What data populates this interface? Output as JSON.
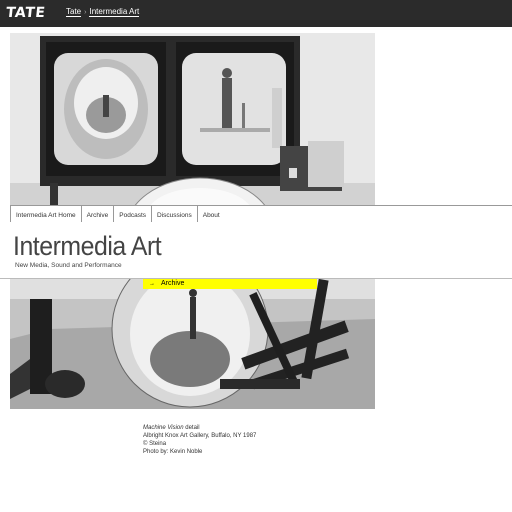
{
  "header": {
    "logo": "TATE",
    "breadcrumb": [
      "Tate",
      "Intermedia Art"
    ]
  },
  "nav": {
    "items": [
      "Intermedia Art Home",
      "Archive",
      "Podcasts",
      "Discussions",
      "About"
    ]
  },
  "page": {
    "title": "Intermedia Art",
    "subtitle": "New Media, Sound and Performance"
  },
  "archive_link": {
    "label": "Archive"
  },
  "caption": {
    "work_title": "Machine Vision",
    "work_suffix": " detail",
    "line2": "Albright Knox Art Gallery, Buffalo, NY 1987",
    "line3": "© Steina",
    "line4": "Photo by: Kevin Noble"
  },
  "colors": {
    "topbar": "#2b2b2b",
    "accent": "#ffff00"
  }
}
